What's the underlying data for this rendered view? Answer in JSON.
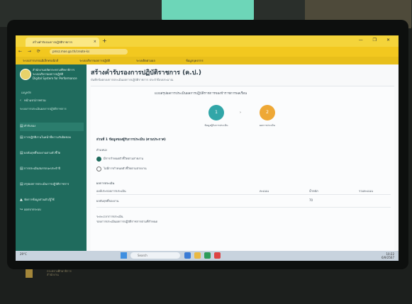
{
  "browser": {
    "tab_title": "สร้างคำรับรองการปฏิบัติราชการ",
    "tab_close": "×",
    "new_tab": "+",
    "url": "pmsz.moe.go.th/create-ks",
    "window_controls": "— ❐ ✕",
    "bookmarks": [
      "ระบบสารบรรณอิเล็กทรอนิกส์",
      "ระบบบริหารผลการปฏิบัติ",
      "ระบบติดตามผล",
      "ข้อมูลบุคลากร"
    ]
  },
  "sidebar": {
    "brand_lines": [
      "สำนักงานปลัดกระทรวงศึกษาธิการ",
      "ระบบบริหารผลการปฏิบัติ",
      "Digital System for Performance"
    ],
    "menu_heading": "เมนูหลัก",
    "items": [
      {
        "icon": "‹",
        "label": "หน้าแรก/ภาพรวม"
      },
      {
        "icon": "",
        "label": "ระบบการประเมินผลการปฏิบัติราชการ"
      },
      {
        "icon": "▤",
        "label": "คำรับรอง"
      },
      {
        "icon": "▤",
        "label": "การปฏิบัติงานในหน้าที่ความรับผิดชอบ"
      },
      {
        "icon": "▤",
        "label": "ผลสัมฤทธิ์ของงานตามตัวชี้วัด"
      },
      {
        "icon": "▤",
        "label": "การประเมินสมรรถนะประจำปี"
      },
      {
        "icon": "▤",
        "label": "สรุปผลการประเมินการปฏิบัติราชการ"
      },
      {
        "icon": "▲",
        "label": "จัดการข้อมูลส่วนตัว/ผู้ใช้"
      },
      {
        "icon": "↪",
        "label": "ออกจากระบบ"
      }
    ]
  },
  "main": {
    "title": "สร้างคำรับรองการปฏิบัติราชการ (ค.ป.)",
    "subtitle": "บันทึกข้อตกลงการประเมินผลการปฏิบัติราชการ ประจำปีงบประมาณ",
    "step_heading": "แบบสรุปผลการประเมินผลการปฏิบัติราชการของข้าราชการพลเรือน",
    "steps": [
      {
        "number": "1",
        "label": "ข้อมูลผู้รับการประเมิน"
      },
      {
        "number": "2",
        "label": "ผลการประเมิน"
      }
    ],
    "step_separator": "›",
    "section_label": "ส่วนที่ 1 ข้อมูลของผู้รับการประเมิน (ตามประกาศ)",
    "options": [
      {
        "label": "ตำแหน่ง",
        "selected": false
      },
      {
        "label": "มีการกำหนดตัวชี้วัดตามสายงาน",
        "selected": true
      },
      {
        "label": "ไม่มีการกำหนดตัวชี้วัดตามสายงาน",
        "selected": false
      }
    ],
    "results_heading": "ผลการประเมิน",
    "table": [
      {
        "c1": "องค์ประกอบการประเมิน",
        "c2": "คะแนน",
        "c3": "น้ำหนัก",
        "c4": "รวมคะแนน"
      },
      {
        "c1": "ผลสัมฤทธิ์ของงาน",
        "c2": "",
        "c3": "70",
        "c4": ""
      }
    ],
    "field_lines": [
      "ระยะเวลาการประเมิน",
      "รอบการประเมินผลการปฏิบัติราชการตามที่กำหนด"
    ]
  },
  "taskbar": {
    "weather": "29°C",
    "search": "Search",
    "time": "10:22",
    "date": "6/9/2567"
  },
  "below_screen": {
    "lines": [
      "กระทรวงศึกษาธิการ",
      "สำนักงาน"
    ]
  },
  "colors": {
    "browser_yellow": "#f2c81f",
    "sidebar_green": "#1f6b5d",
    "step1_teal": "#31a6a8",
    "step2_orange": "#eea836"
  }
}
